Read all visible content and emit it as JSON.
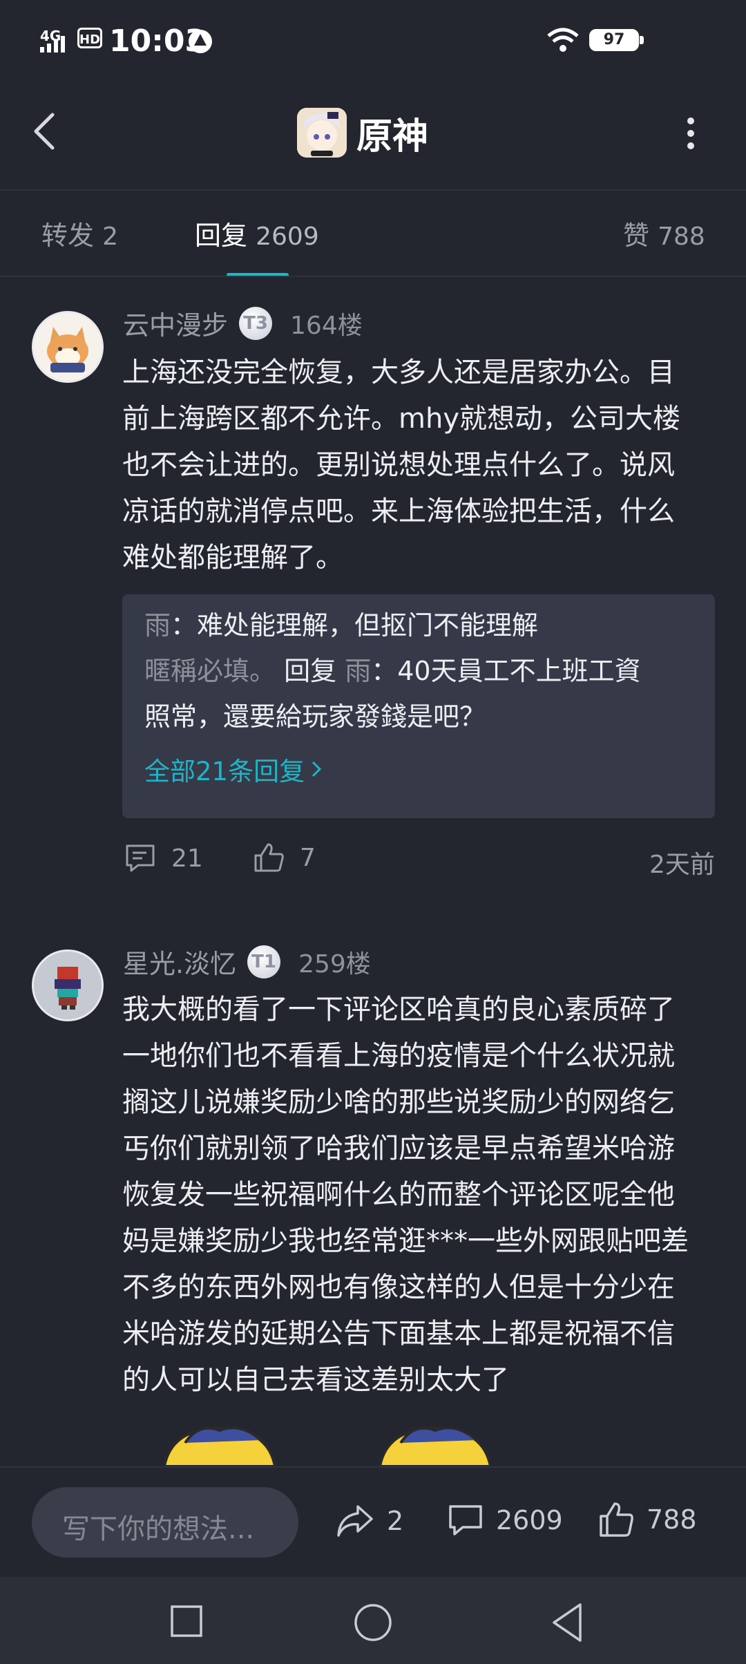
{
  "status_bar": {
    "network": "4G",
    "hd": "HD",
    "time": "10:03",
    "battery": "97"
  },
  "header": {
    "title": "原神"
  },
  "tabs": [
    {
      "label": "转发",
      "count": "2"
    },
    {
      "label": "回复",
      "count": "2609"
    },
    {
      "label": "赞",
      "count": "788"
    }
  ],
  "comments": [
    {
      "username": "云中漫步",
      "level": "T3",
      "floor": "164楼",
      "lines": [
        "上海还没完全恢复，大多人还是居家办公。目",
        "前上海跨区都不允许。mhy就想动，公司大楼",
        "也不会让进的。更别说想处理点什么了。说风",
        "凉话的就消停点吧。来上海体验把生活，什么",
        "难处都能理解了。"
      ],
      "replies": [
        {
          "from": "雨",
          "to": "",
          "text": "难处能理解，但抠门不能理解"
        },
        {
          "from": "暱稱必填。",
          "reply_word": "回复",
          "to": "雨",
          "text_lines": [
            "40天員工不上班工資",
            "照常，還要給玩家發錢是吧？"
          ]
        }
      ],
      "all_replies_link": "全部21条回复",
      "reply_count": "21",
      "like_count": "7",
      "time": "2天前"
    },
    {
      "username": "星光.淡忆",
      "level": "T1",
      "floor": "259楼",
      "lines": [
        "我大概的看了一下评论区哈真的良心素质碎了",
        "一地你们也不看看上海的疫情是个什么状况就",
        "搁这儿说嫌奖励少啥的那些说奖励少的网络乞",
        "丐你们就别领了哈我们应该是早点希望米哈游",
        "恢复发一些祝福啊什么的而整个评论区呢全他",
        "妈是嫌奖励少我也经常逛***一些外网跟贴吧差",
        "不多的东西外网也有像这样的人但是十分少在",
        "米哈游发的延期公告下面基本上都是祝福不信",
        "的人可以自己去看这差别太大了"
      ]
    }
  ],
  "bottom_bar": {
    "input_placeholder": "写下你的想法...",
    "share_count": "2",
    "comment_count": "2609",
    "like_count": "788"
  },
  "colors": {
    "background": "#24262f",
    "accent": "#22b5c4",
    "reply_box": "#363a48"
  }
}
